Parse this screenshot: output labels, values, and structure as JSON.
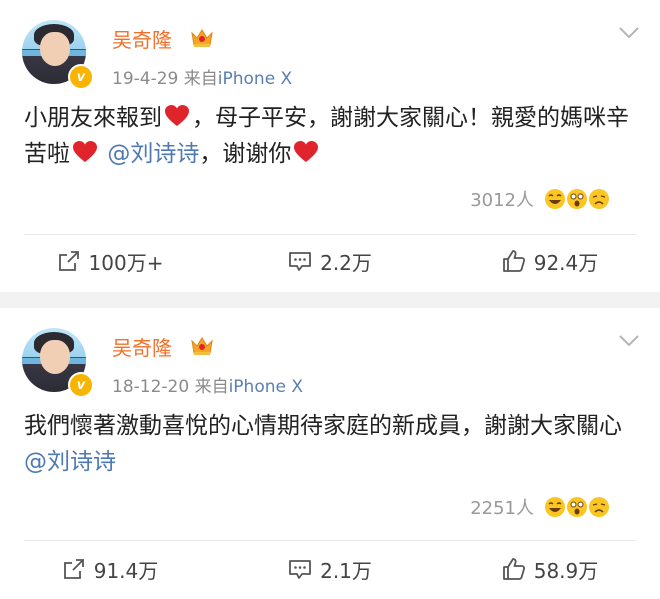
{
  "posts": [
    {
      "username": "吴奇隆",
      "date": "19-4-29",
      "source_prefix": "来自",
      "device": "iPhone X",
      "content_parts": [
        "小朋友來報到",
        "，母子平安，謝謝大家關心！親愛的媽咪辛苦啦",
        "@刘诗诗",
        "，谢谢你"
      ],
      "reaction_count": "3012人",
      "repost": "100万+",
      "comments": "2.2万",
      "likes": "92.4万"
    },
    {
      "username": "吴奇隆",
      "date": "18-12-20",
      "source_prefix": "来自",
      "device": "iPhone X",
      "content_parts": [
        "我們懷著激動喜悅的心情期待家庭的新成員，謝謝大家關心 ",
        "@刘诗诗"
      ],
      "reaction_count": "2251人",
      "repost": "91.4万",
      "comments": "2.1万",
      "likes": "58.9万"
    }
  ],
  "colors": {
    "username": "#f4702a",
    "mention": "#4d79b4",
    "meta": "#8b8b8b",
    "heart": "#e0242c",
    "verified_badge": "#f8b400"
  },
  "icons": {
    "verified": "v",
    "repost": "repost-icon",
    "comment": "comment-icon",
    "like": "thumbs-up-icon",
    "more": "chevron-down-icon"
  }
}
